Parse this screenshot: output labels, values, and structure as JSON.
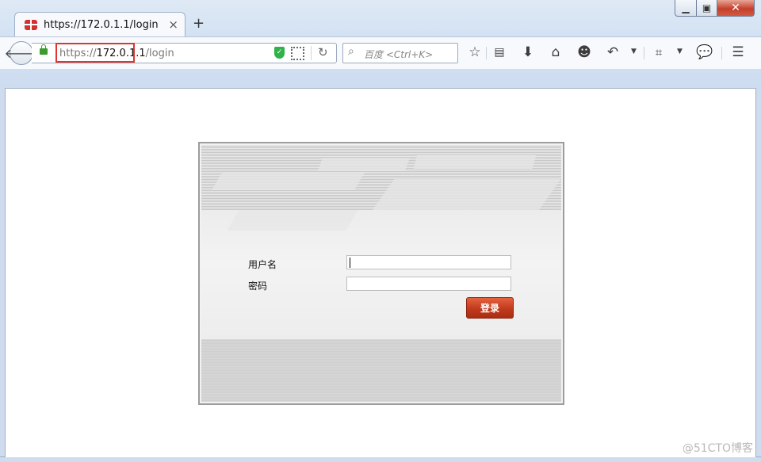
{
  "browser": {
    "tab_title": "https://172.0.1.1/login",
    "new_tab_label": "+",
    "tab_close_label": "×",
    "url_prefix": "https://",
    "url_host": "172.0.1.1",
    "url_path": "/login",
    "search_placeholder": "百度 <Ctrl+K>",
    "window_controls": {
      "minimize": "▁",
      "maximize": "▣",
      "close": "✕"
    },
    "accent_highlight_color": "#e0342e"
  },
  "login": {
    "username_label": "用户名",
    "password_label": "密码",
    "username_value": "",
    "password_value": "",
    "submit_label": "登录",
    "button_color": "#c13a1c"
  },
  "watermark": "@51CTO博客"
}
